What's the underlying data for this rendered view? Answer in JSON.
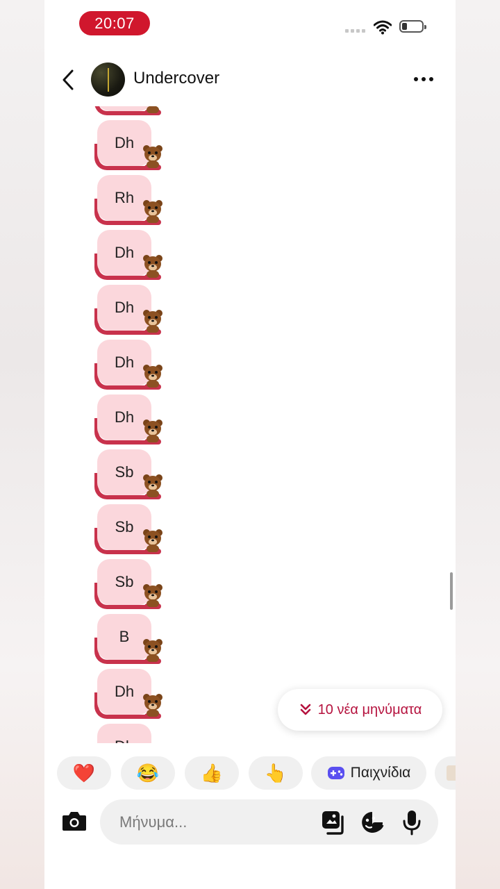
{
  "status_bar": {
    "time": "20:07"
  },
  "header": {
    "contact_name": "Undercover"
  },
  "messages": [
    {
      "text": ""
    },
    {
      "text": "Dh"
    },
    {
      "text": "Rh"
    },
    {
      "text": "Dh"
    },
    {
      "text": "Dh"
    },
    {
      "text": "Dh"
    },
    {
      "text": "Dh"
    },
    {
      "text": "Sb"
    },
    {
      "text": "Sb"
    },
    {
      "text": "Sb"
    },
    {
      "text": "B"
    },
    {
      "text": "Dh"
    },
    {
      "text": "Dh"
    }
  ],
  "new_messages_button": {
    "label": "10 νέα μηνύματα"
  },
  "quick_replies": [
    {
      "icon": "red-heart-emoji",
      "glyph": "❤️"
    },
    {
      "icon": "tears-of-joy-emoji",
      "glyph": "😂"
    },
    {
      "icon": "thumbs-up-emoji",
      "glyph": "👍"
    },
    {
      "icon": "pointing-hand-emoji",
      "glyph": "👆"
    }
  ],
  "games_chip": {
    "label": "Παιχνίδια"
  },
  "composer": {
    "placeholder": "Μήνυμα..."
  },
  "colors": {
    "accent": "#b5123e",
    "bubble": "#fbd7dc",
    "bubble_tail": "#c8324c",
    "time_pill": "#d0172d"
  }
}
